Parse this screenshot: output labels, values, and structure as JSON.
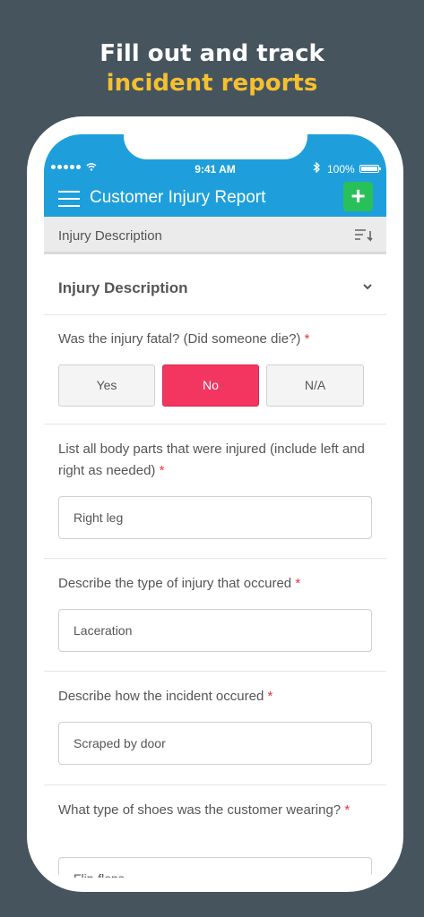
{
  "promo": {
    "line1": "Fill out and track",
    "line2": "incident reports"
  },
  "status_bar": {
    "time": "9:41 AM",
    "battery": "100%"
  },
  "header": {
    "title": "Customer Injury Report",
    "add_label": "+"
  },
  "subbar": {
    "label": "Injury Description"
  },
  "section": {
    "title": "Injury Description"
  },
  "questions": {
    "fatal": {
      "label": "Was the injury fatal? (Did someone die?)",
      "required": "*",
      "options": [
        "Yes",
        "No",
        "N/A"
      ],
      "selected": "No"
    },
    "body_parts": {
      "label": "List all body parts that were injured (include left and right as needed)",
      "required": "*",
      "value": "Right leg"
    },
    "injury_type": {
      "label": "Describe the type of injury that occured",
      "required": "*",
      "value": "Laceration"
    },
    "how": {
      "label": "Describe how the incident occured",
      "required": "*",
      "value": "Scraped by door"
    },
    "shoes": {
      "label": "What type of shoes was the customer wearing?",
      "required": "*",
      "value": "Flip-flops"
    }
  },
  "colors": {
    "accent": "#1e9fdc",
    "add": "#29c05a",
    "selected": "#f33660",
    "promo": "#f5c02e"
  }
}
